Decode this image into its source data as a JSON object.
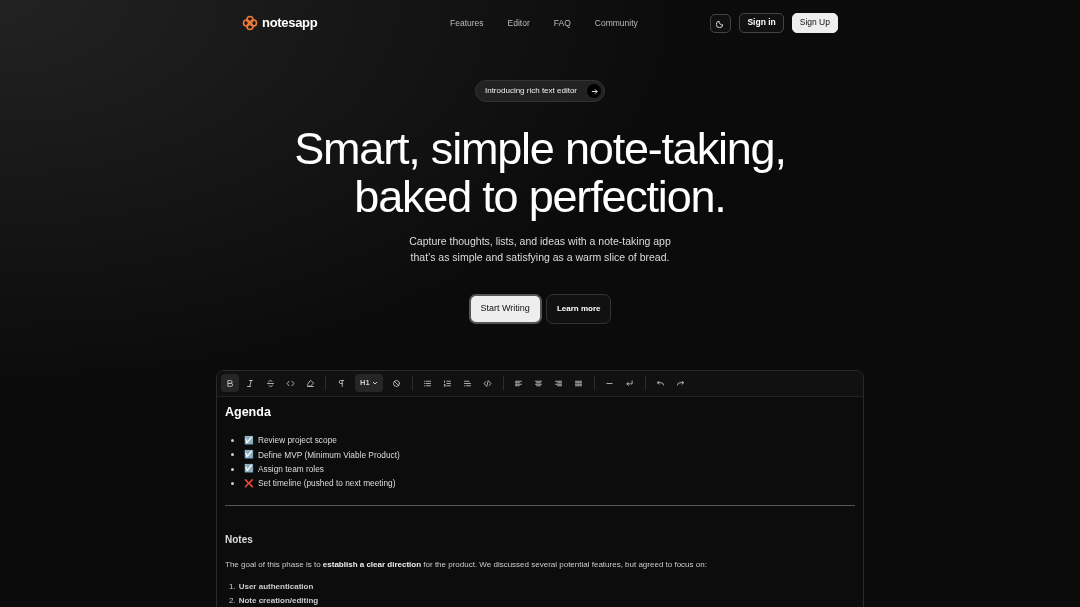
{
  "brand": "notesapp",
  "nav": [
    "Features",
    "Editor",
    "FAQ",
    "Community"
  ],
  "auth": {
    "sign_in": "Sign in",
    "sign_up": "Sign Up"
  },
  "announcement": "Introducing rich text editor",
  "headline": [
    "Smart, simple note-taking,",
    "baked to perfection."
  ],
  "subtitle": [
    "Capture thoughts, lists, and ideas with a note-taking app",
    "that’s as simple and satisfying as a warm slice of bread."
  ],
  "cta": {
    "primary": "Start Writing",
    "secondary": "Learn more"
  },
  "toolbar": [
    {
      "kind": "icon",
      "selected": true
    },
    {
      "kind": "icon",
      "selected": false
    },
    {
      "kind": "icon",
      "selected": false
    },
    {
      "kind": "icon",
      "selected": false
    },
    {
      "kind": "icon",
      "selected": false
    },
    {
      "kind": "sep"
    },
    {
      "kind": "icon",
      "selected": false
    },
    {
      "kind": "dropdown",
      "label": "H1",
      "selected": true
    },
    {
      "kind": "icon",
      "selected": false
    },
    {
      "kind": "sep"
    },
    {
      "kind": "icon",
      "selected": false
    },
    {
      "kind": "icon",
      "selected": false
    },
    {
      "kind": "icon",
      "selected": false
    },
    {
      "kind": "icon",
      "selected": false
    },
    {
      "kind": "sep"
    },
    {
      "kind": "icon",
      "selected": false
    },
    {
      "kind": "icon",
      "selected": false
    },
    {
      "kind": "icon",
      "selected": false
    },
    {
      "kind": "icon",
      "selected": false
    },
    {
      "kind": "sep"
    },
    {
      "kind": "icon",
      "selected": false
    },
    {
      "kind": "icon",
      "selected": false
    },
    {
      "kind": "sep"
    },
    {
      "kind": "icon",
      "selected": false
    },
    {
      "kind": "icon",
      "selected": false
    }
  ],
  "document": {
    "heading": "Agenda",
    "agenda": [
      {
        "mark": "☑️",
        "text": "Review project scope"
      },
      {
        "mark": "☑️",
        "text": "Define MVP (Minimum Viable Product)"
      },
      {
        "mark": "☑️",
        "text": "Assign team roles"
      },
      {
        "mark": "❌",
        "text": "Set timeline (pushed to next meeting)"
      }
    ],
    "notes_heading": "Notes",
    "paragraph": "The goal of this phase is to **establish a clear direction** for the product. We discussed several potential features, but agreed to focus on:",
    "focus": [
      {
        "number": "1.",
        "text": "User authentication"
      },
      {
        "number": "2.",
        "text": "Note creation/editing"
      }
    ]
  }
}
